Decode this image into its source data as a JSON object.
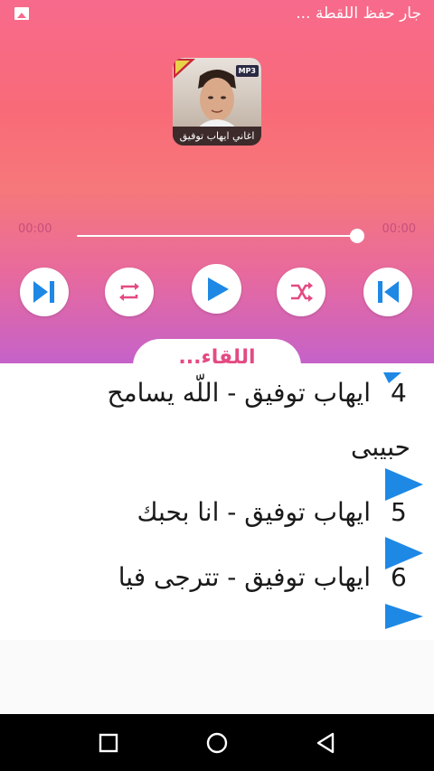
{
  "status": {
    "text": "جار حفظ اللقطة ..."
  },
  "cover": {
    "caption": "اغاني ايهاب توفيق",
    "badge": "MP3"
  },
  "player": {
    "elapsed": "00:00",
    "duration": "00:00",
    "progress": 1.0
  },
  "tab": {
    "label": "اللقاء..."
  },
  "songs": [
    {
      "num": "4",
      "title_line1": "ايهاب توفيق - اللّه يسامح",
      "title_line2": "حبيبى"
    },
    {
      "num": "5",
      "title_line1": "ايهاب توفيق - انا بحبك"
    },
    {
      "num": "6",
      "title_line1": "ايهاب توفيق - تترجى فيا"
    }
  ],
  "colors": {
    "accent": "#1e88e5",
    "header_top": "#f76a8c",
    "header_bottom": "#c562c9"
  },
  "icons": [
    "gallery-icon",
    "skip-next-icon",
    "repeat-icon",
    "play-icon",
    "shuffle-icon",
    "skip-previous-icon",
    "nav-recents-icon",
    "nav-home-icon",
    "nav-back-icon"
  ]
}
